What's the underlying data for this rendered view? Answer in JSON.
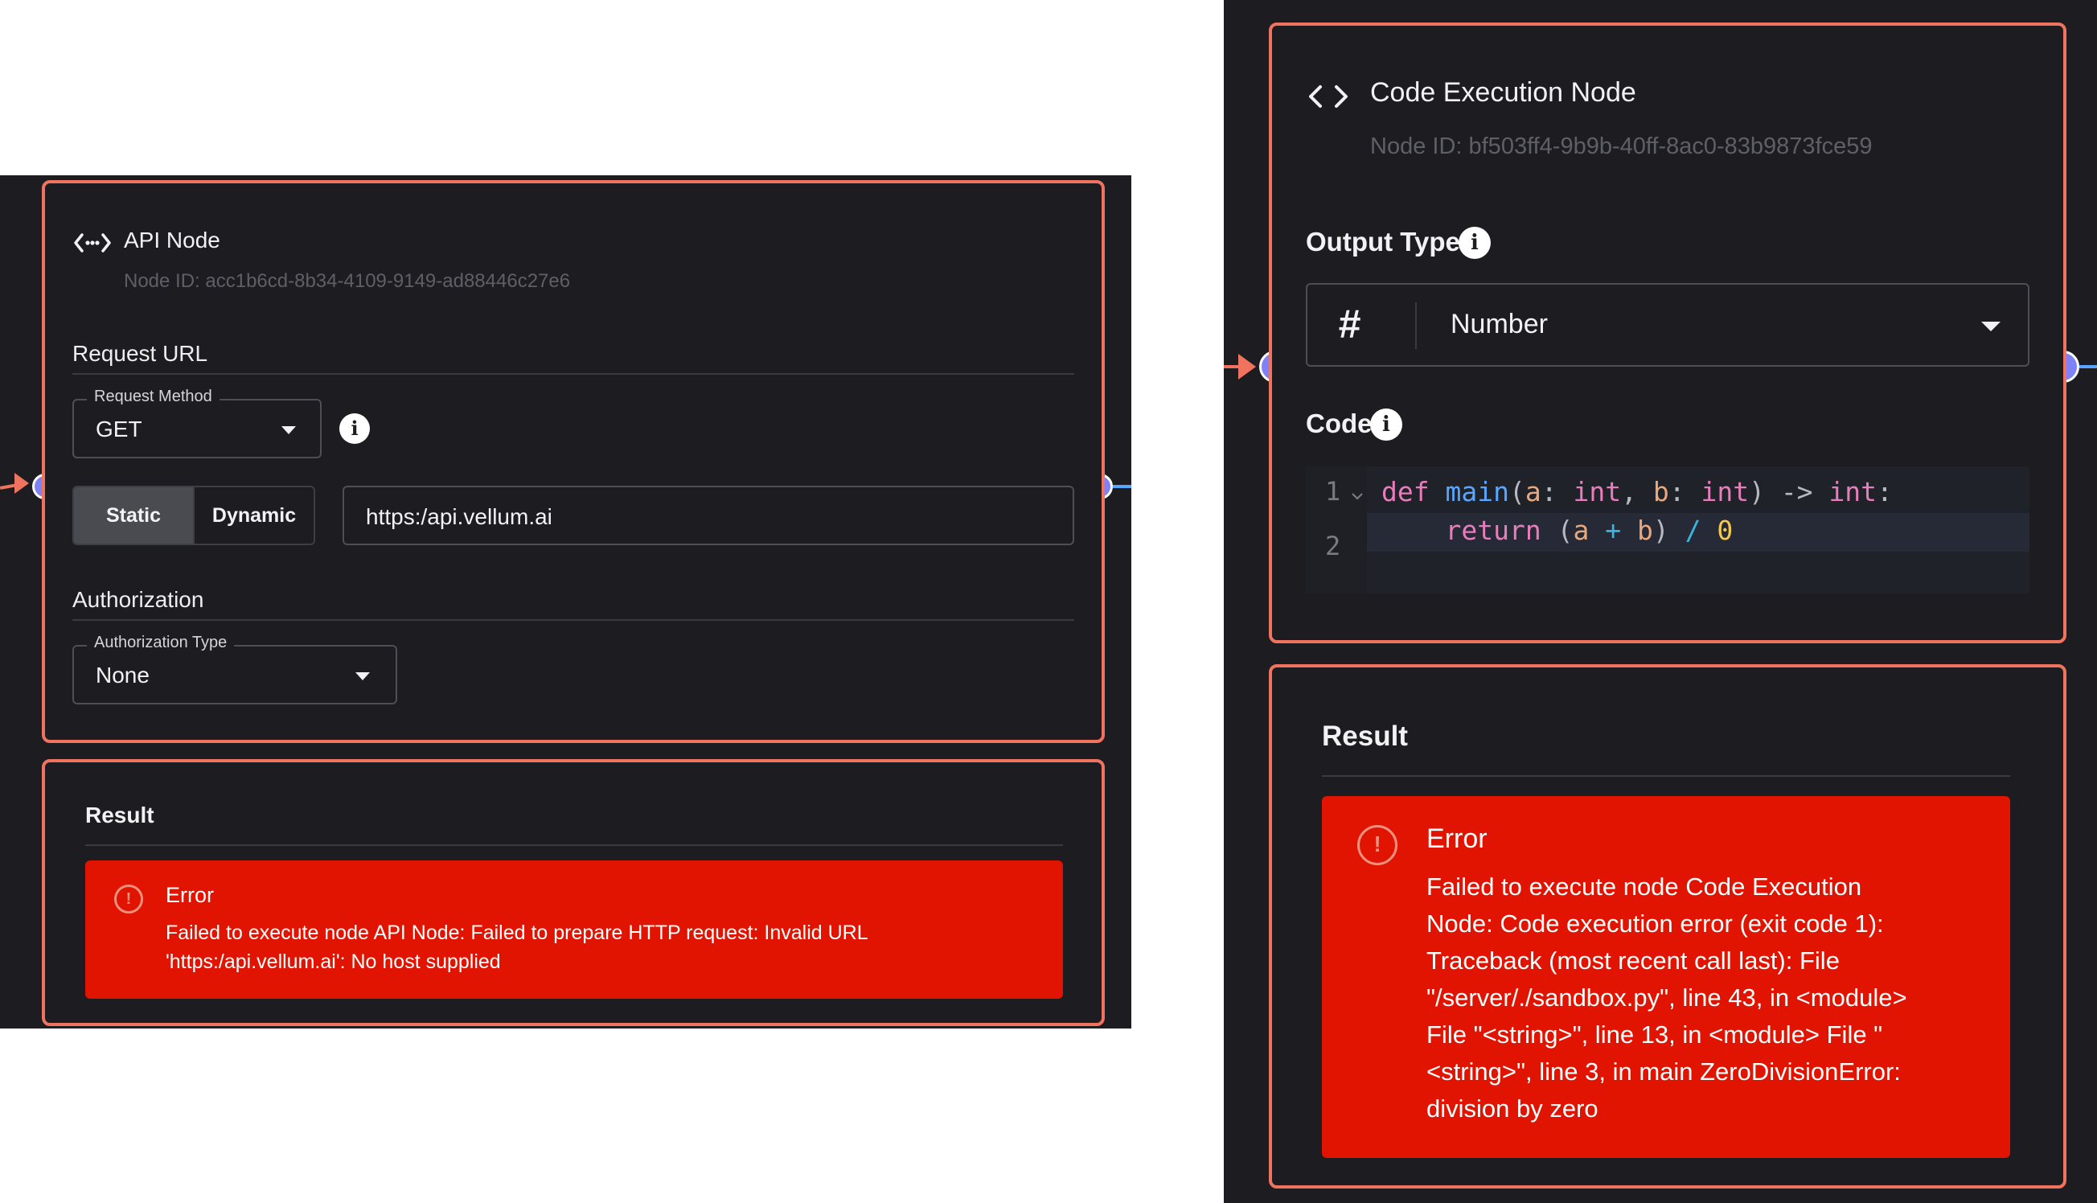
{
  "api_node": {
    "title": "API Node",
    "node_id": "Node ID: acc1b6cd-8b34-4109-9149-ad88446c27e6",
    "request_url_heading": "Request URL",
    "request_method_label": "Request Method",
    "request_method_value": "GET",
    "toggle": {
      "static_label": "Static",
      "dynamic_label": "Dynamic",
      "selected": "Static"
    },
    "url_value": "https:/api.vellum.ai",
    "authorization_heading": "Authorization",
    "authorization_type_label": "Authorization Type",
    "authorization_type_value": "None",
    "result": {
      "heading": "Result",
      "error_title": "Error",
      "error_line_1": "Failed to execute node API Node: Failed to prepare HTTP request: Invalid URL",
      "error_line_2": "'https:/api.vellum.ai': No host supplied"
    }
  },
  "code_node": {
    "title": "Code Execution Node",
    "node_id": "Node ID: bf503ff4-9b9b-40ff-8ac0-83b9873fce59",
    "output_type_heading": "Output Type",
    "output_type_icon": "#",
    "output_type_value": "Number",
    "code_heading": "Code",
    "code_lines": [
      {
        "number": "1",
        "text": "def main(a: int, b: int) -> int:"
      },
      {
        "number": "2",
        "text": "    return (a + b) / 0"
      }
    ],
    "result": {
      "heading": "Result",
      "error_title": "Error",
      "error_lines": [
        "Failed to execute node Code Execution",
        "Node: Code execution error (exit code 1):",
        "Traceback (most recent call last): File",
        "\"/server/./sandbox.py\", line 43, in <module>",
        "File \"<string>\", line 13, in <module> File \"",
        "<string>\", line 3, in main ZeroDivisionError:",
        "division by zero"
      ]
    }
  },
  "colors": {
    "node_border": "#f0735f",
    "panel_bg": "#1d1d21",
    "port": "#7f81f7",
    "error_bg": "#e01400",
    "edge_out": "#58a6ff"
  }
}
